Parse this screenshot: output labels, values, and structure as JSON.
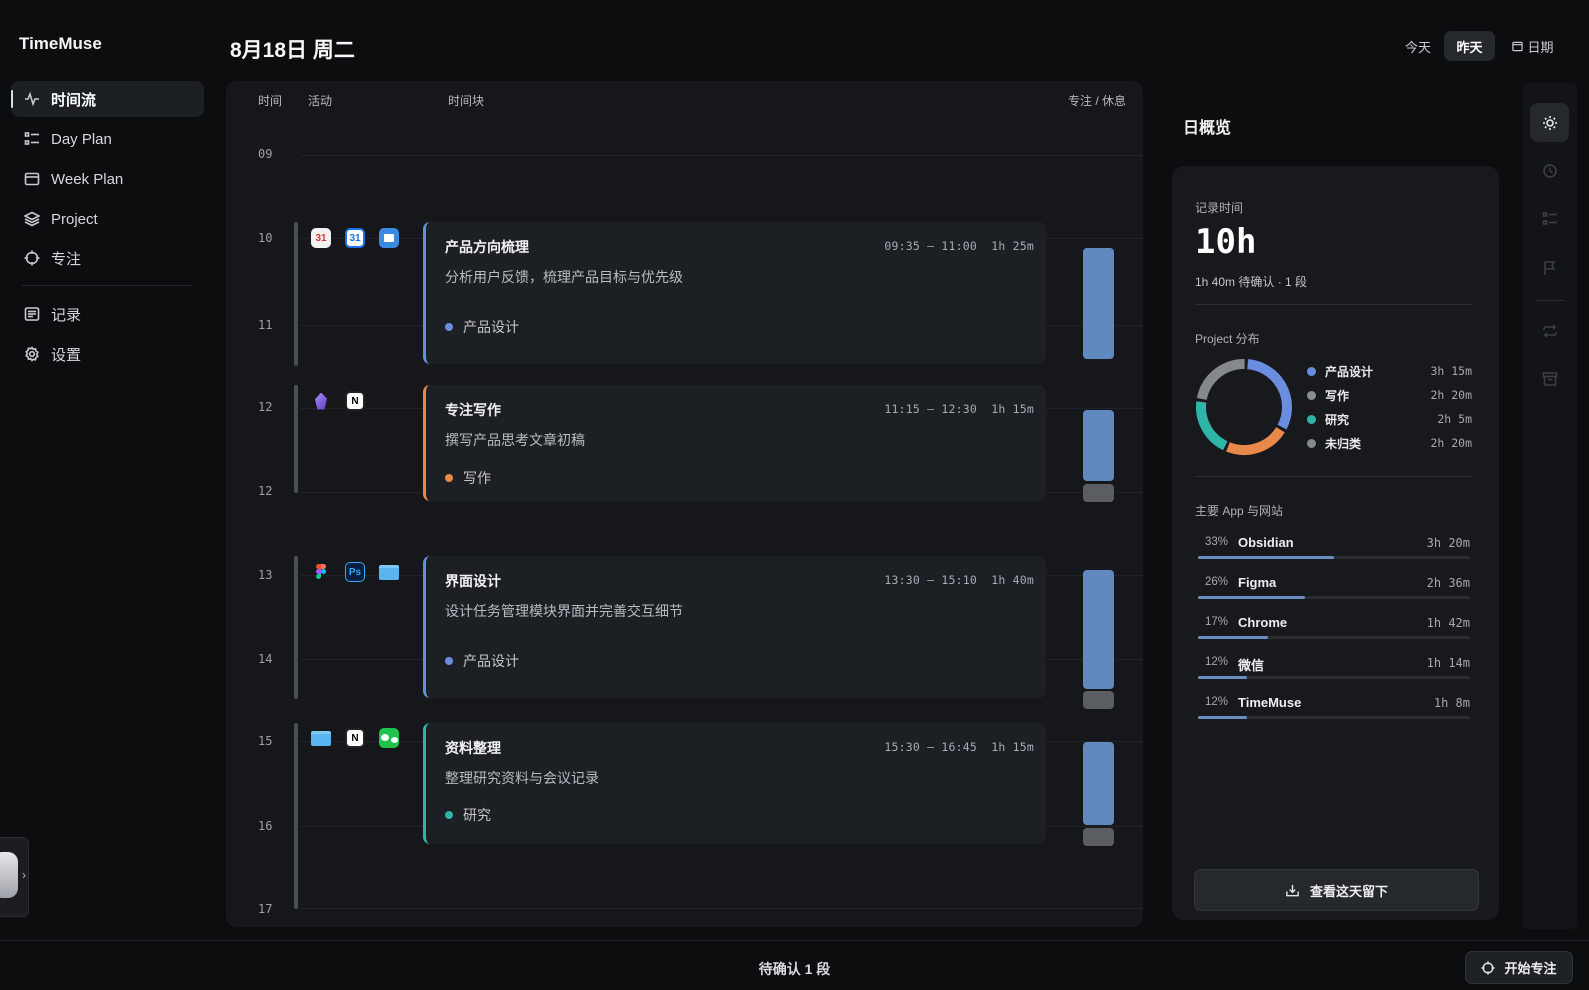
{
  "app": {
    "name": "TimeMuse"
  },
  "sidebar": {
    "items": [
      {
        "label": "时间流",
        "icon": "activity-icon"
      },
      {
        "label": "Day Plan",
        "icon": "list-icon"
      },
      {
        "label": "Week Plan",
        "icon": "calendar-icon"
      },
      {
        "label": "Project",
        "icon": "layers-icon"
      },
      {
        "label": "专注",
        "icon": "crosshair-icon"
      },
      {
        "label": "记录",
        "icon": "notes-icon"
      },
      {
        "label": "设置",
        "icon": "gear-icon"
      }
    ]
  },
  "header": {
    "date": "8月18日 周二",
    "today": "今天",
    "yesterday": "昨天",
    "date_picker": "日期"
  },
  "timeline": {
    "headers": {
      "time": "时间",
      "activity": "活动",
      "blocks": "时间块",
      "focus": "专注 / 休息"
    },
    "hours": [
      "09",
      "10",
      "11",
      "12",
      "12",
      "13",
      "14",
      "15",
      "16",
      "17"
    ],
    "blocks": [
      {
        "title": "产品方向梳理",
        "desc": "分析用户反馈，梳理产品目标与优先级",
        "time": "09:35 – 11:00",
        "duration": "1h 25m",
        "tag": "产品设计",
        "tag_color": "#6b8de0",
        "apps": [
          "calendar-app-icon",
          "google-calendar-icon",
          "preview-icon"
        ]
      },
      {
        "title": "专注写作",
        "desc": "撰写产品思考文章初稿",
        "time": "11:15 – 12:30",
        "duration": "1h 15m",
        "tag": "写作",
        "tag_color": "#e8894a",
        "apps": [
          "obsidian-icon",
          "notion-icon"
        ]
      },
      {
        "title": "界面设计",
        "desc": "设计任务管理模块界面并完善交互细节",
        "time": "13:30 – 15:10",
        "duration": "1h 40m",
        "tag": "产品设计",
        "tag_color": "#6b8de0",
        "apps": [
          "figma-icon",
          "photoshop-icon",
          "folder-icon"
        ]
      },
      {
        "title": "资料整理",
        "desc": "整理研究资料与会议记录",
        "time": "15:30 – 16:45",
        "duration": "1h 15m",
        "tag": "研究",
        "tag_color": "#2fb5a8",
        "apps": [
          "folder-icon",
          "notion-icon",
          "wechat-icon"
        ]
      }
    ],
    "icon_labels": {
      "calendar": "31",
      "gcal": "31",
      "ps": "Ps",
      "notion": "N"
    }
  },
  "overview": {
    "title": "日概览",
    "recorded_label": "记录时间",
    "recorded_value": "10h",
    "recorded_sub": "1h 40m 待确认 · 1 段",
    "project_label": "Project 分布",
    "projects": [
      {
        "name": "产品设计",
        "duration": "3h 15m",
        "color": "#6b8de0",
        "minutes": 195
      },
      {
        "name": "写作",
        "duration": "2h 20m",
        "color": "#e8894a",
        "minutes": 140
      },
      {
        "name": "研究",
        "duration": "2h  5m",
        "color": "#2fb5a8",
        "minutes": 125
      },
      {
        "name": "未归类",
        "duration": "2h 20m",
        "color": "#85888d",
        "minutes": 140
      }
    ],
    "legend_dot_colors": [
      "#6b8de0",
      "#8a8d92",
      "#2fb5a8",
      "#85888d"
    ],
    "apps_label": "主要 App 与网站",
    "apps": [
      {
        "pct": "33%",
        "name": "Obsidian",
        "duration": "3h 20m",
        "share": 0.33
      },
      {
        "pct": "26%",
        "name": "Figma",
        "duration": "2h 36m",
        "share": 0.26
      },
      {
        "pct": "17%",
        "name": "Chrome",
        "duration": "1h 42m",
        "share": 0.17
      },
      {
        "pct": "12%",
        "name": "微信",
        "duration": "1h 14m",
        "share": 0.12
      },
      {
        "pct": "12%",
        "name": "TimeMuse",
        "duration": "1h  8m",
        "share": 0.12
      }
    ],
    "keep_button": "查看这天留下"
  },
  "rail": {
    "icons": [
      "sun-icon",
      "history-icon",
      "checklist-icon",
      "flag-icon",
      "repeat-icon",
      "archive-icon"
    ]
  },
  "footer": {
    "pending": "待确认 1 段",
    "start_focus": "开始专注"
  }
}
